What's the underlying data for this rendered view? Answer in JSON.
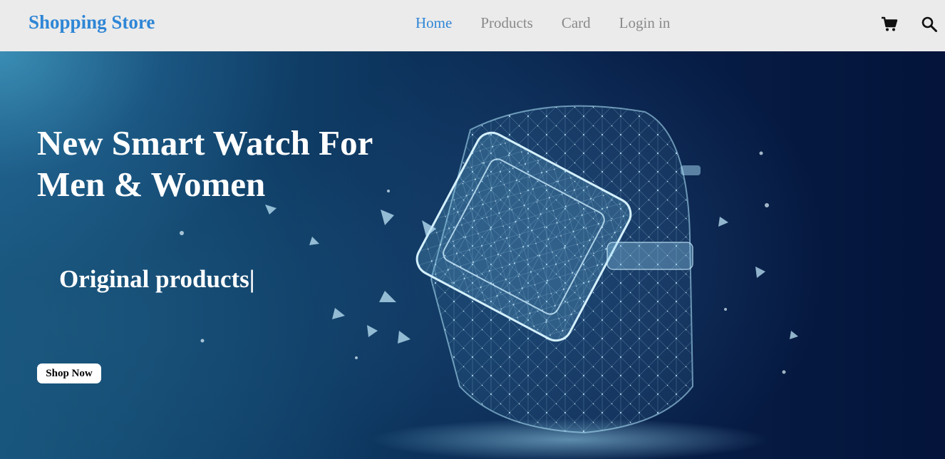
{
  "navbar": {
    "brand": "Shopping Store",
    "links": [
      {
        "label": "Home",
        "active": true
      },
      {
        "label": "Products",
        "active": false
      },
      {
        "label": "Card",
        "active": false
      },
      {
        "label": "Login in",
        "active": false
      }
    ],
    "icons": [
      "cart-icon",
      "search-icon"
    ]
  },
  "hero": {
    "title_line1": "New Smart Watch For",
    "title_line2": "Men & Women",
    "subtitle": "Original products|",
    "button_label": "Shop Now",
    "image": "wireframe-smart-watch-illustration"
  },
  "colors": {
    "accent": "#2f86d6",
    "nav_background": "#ebebeb",
    "nav_link": "#8a8a8a",
    "hero_dark": "#04143a"
  }
}
